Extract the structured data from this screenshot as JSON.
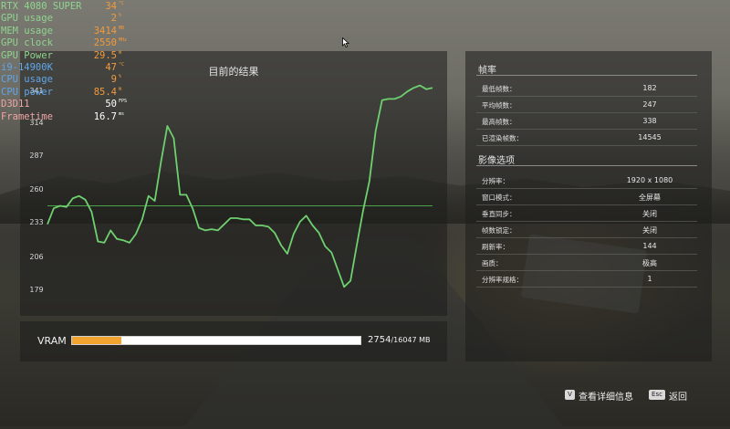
{
  "osd": {
    "rows": [
      {
        "name": "RTX 4080 SUPER",
        "value": "34",
        "unit": "°C",
        "name_color": "#8fd48f",
        "value_color": "#f29a3c"
      },
      {
        "name": "GPU usage",
        "value": "2",
        "unit": "%",
        "name_color": "#8fd48f",
        "value_color": "#f29a3c"
      },
      {
        "name": "MEM usage",
        "value": "3414",
        "unit": "MB",
        "name_color": "#8fd48f",
        "value_color": "#f29a3c"
      },
      {
        "name": "GPU clock",
        "value": "2550",
        "unit": "MHz",
        "name_color": "#8fd48f",
        "value_color": "#f29a3c"
      },
      {
        "name": "GPU Power",
        "value": "29.5",
        "unit": "W",
        "name_color": "#8fd48f",
        "value_color": "#f29a3c"
      },
      {
        "name": "i9-14900K",
        "value": "47",
        "unit": "°C",
        "name_color": "#5fa6e8",
        "value_color": "#f29a3c"
      },
      {
        "name": "CPU usage",
        "value": "9",
        "unit": "%",
        "name_color": "#5fa6e8",
        "value_color": "#f29a3c"
      },
      {
        "name": "CPU power",
        "value": "85.4",
        "unit": "W",
        "name_color": "#5fa6e8",
        "value_color": "#f29a3c"
      },
      {
        "name": "D3D11",
        "value": "50",
        "unit": "FPS",
        "name_color": "#f0a6a6",
        "value_color": "#ffffff"
      },
      {
        "name": "Frametime",
        "value": "16.7",
        "unit": "ms",
        "name_color": "#f0a6a6",
        "value_color": "#ffffff"
      }
    ]
  },
  "graph": {
    "title": "目前的结果",
    "y_ticks": [
      "341",
      "314",
      "287",
      "260",
      "233",
      "206",
      "179"
    ]
  },
  "chart_data": {
    "type": "line",
    "title": "目前的结果",
    "xlabel": "",
    "ylabel": "",
    "ylim": [
      179,
      341
    ],
    "y_ticks": [
      179,
      206,
      233,
      260,
      287,
      314,
      341
    ],
    "grid": false,
    "average_line": 247,
    "line_color": "#6fd06f",
    "series": [
      {
        "values": [
          232,
          245,
          247,
          246,
          253,
          255,
          252,
          242,
          218,
          217,
          227,
          220,
          219,
          217,
          224,
          236,
          255,
          251,
          283,
          312,
          302,
          256,
          256,
          245,
          229,
          227,
          228,
          227,
          232,
          237,
          237,
          236,
          236,
          231,
          231,
          230,
          225,
          215,
          208,
          224,
          234,
          239,
          231,
          225,
          214,
          209,
          195,
          181,
          186,
          215,
          243,
          267,
          308,
          333,
          334,
          334,
          336,
          340,
          343,
          345,
          342,
          343
        ]
      }
    ]
  },
  "vram": {
    "label": "VRAM",
    "used": "2754",
    "total": "/16047 MB",
    "used_fraction": 0.1716
  },
  "stats": {
    "framerate_title": "帧率",
    "framerate_rows": [
      {
        "key": "最低帧数：",
        "value": "182"
      },
      {
        "key": "平均帧数：",
        "value": "247"
      },
      {
        "key": "最高帧数：",
        "value": "338"
      },
      {
        "key": "已渲染帧数：",
        "value": "14545"
      }
    ],
    "video_title": "影像选项",
    "video_rows": [
      {
        "key": "分辨率：",
        "value": "1920 x 1080"
      },
      {
        "key": "窗口模式：",
        "value": "全屏幕"
      },
      {
        "key": "垂直同步：",
        "value": "关闭"
      },
      {
        "key": "帧数锁定：",
        "value": "关闭"
      },
      {
        "key": "刷新率：",
        "value": "144"
      },
      {
        "key": "画质：",
        "value": "极高"
      },
      {
        "key": "分辨率规格：",
        "value": "1"
      }
    ]
  },
  "footer": {
    "details_key": "V",
    "details_label": "查看详细信息",
    "back_key": "Esc",
    "back_label": "返回"
  }
}
